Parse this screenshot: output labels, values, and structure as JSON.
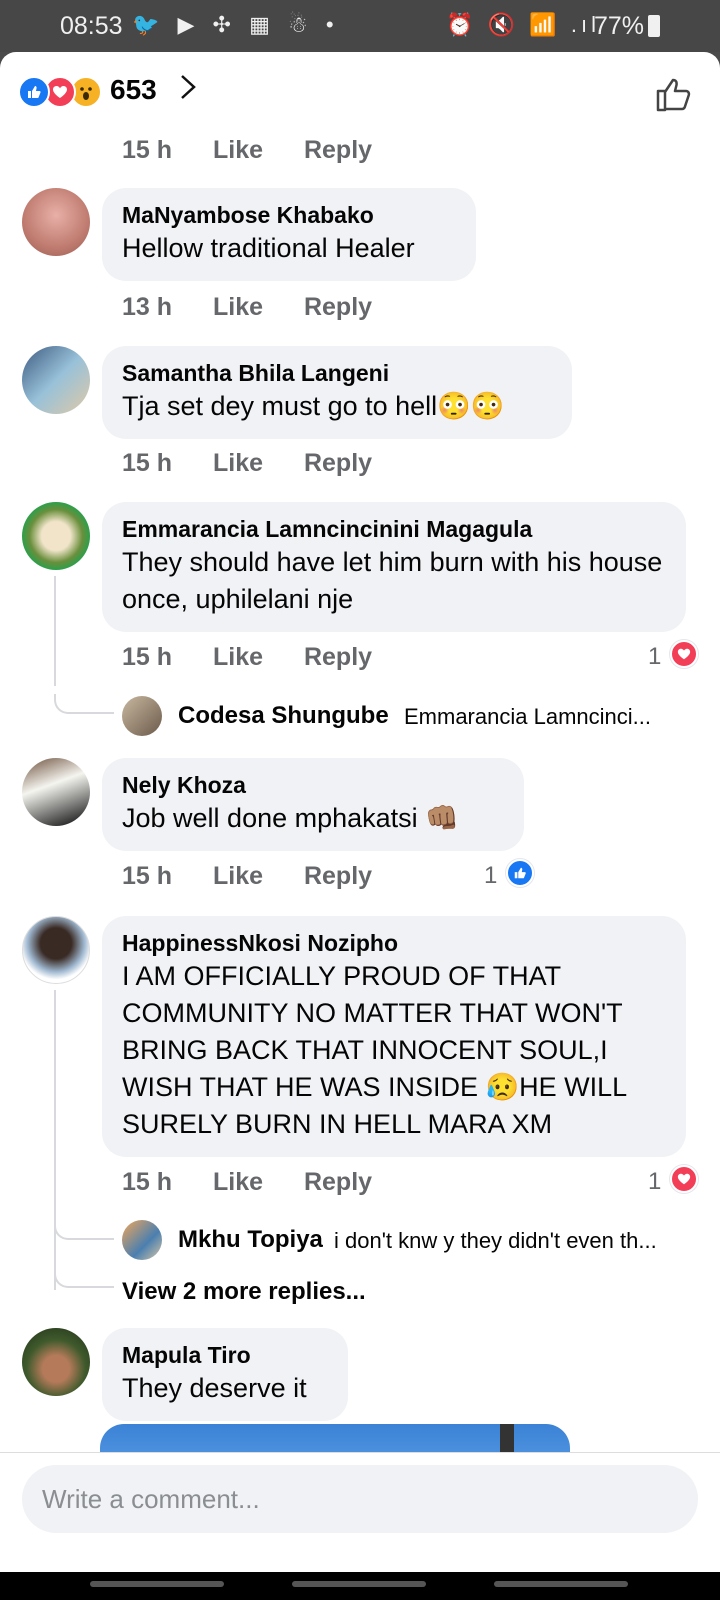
{
  "status": {
    "time": "08:53",
    "left_icons": "🐦 ▶ ✣ ▦ ☃ •",
    "right_icons": "⏰ 🔇 📶 .ıl",
    "battery": "77%"
  },
  "reactions": {
    "count": "653",
    "icons": [
      "like-icon",
      "love-icon",
      "wow-icon"
    ],
    "chevron": ">"
  },
  "first_meta": {
    "time": "15 h",
    "like": "Like",
    "reply": "Reply"
  },
  "comments": [
    {
      "name": "MaNyambose Khabako",
      "text": "Hellow traditional Healer",
      "time": "13 h",
      "like": "Like",
      "reply": "Reply"
    },
    {
      "name": "Samantha Bhila Langeni",
      "text": "Tja set dey must go to hell😳😳",
      "time": "15 h",
      "like": "Like",
      "reply": "Reply"
    },
    {
      "name": "Emmarancia Lamncincinini Magagula",
      "text": "They should have let him burn with his house once, uphilelani nje",
      "time": "15 h",
      "like": "Like",
      "reply": "Reply",
      "reaction_count": "1",
      "reaction_icon": "love-icon",
      "reply_preview": {
        "name": "Codesa Shungube",
        "text": "Emmarancia Lamncinci..."
      }
    },
    {
      "name": "Nely Khoza",
      "text": "Job well done mphakatsi 👊🏽",
      "time": "15 h",
      "like": "Like",
      "reply": "Reply",
      "reaction_count": "1",
      "reaction_icon": "like-icon"
    },
    {
      "name": "HappinessNkosi Nozipho",
      "text": "I AM OFFICIALLY PROUD OF THAT COMMUNITY NO MATTER THAT WON'T BRING BACK THAT INNOCENT SOUL,I WISH THAT HE WAS INSIDE 😥HE WILL SURELY BURN IN HELL MARA XM",
      "time": "15 h",
      "like": "Like",
      "reply": "Reply",
      "reaction_count": "1",
      "reaction_icon": "love-icon",
      "reply_preview": {
        "name": "Mkhu Topiya",
        "text": "i don't knw y they didn't even th..."
      },
      "view_more": "View 2 more replies..."
    },
    {
      "name": "Mapula Tiro",
      "text": "They deserve it"
    }
  ],
  "composer": {
    "placeholder": "Write a comment..."
  },
  "colors": {
    "accent": "#1877f2",
    "love": "#f33e58",
    "bubble": "#f0f2f5",
    "meta": "#65676b"
  }
}
